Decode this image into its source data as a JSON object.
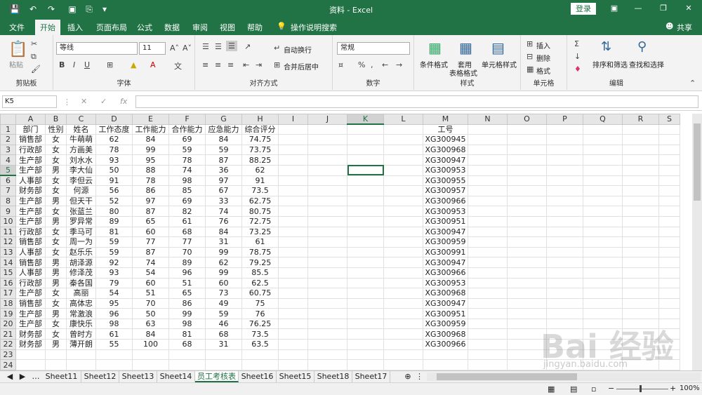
{
  "title": "资料 - Excel",
  "login_label": "登录",
  "share_label": "共享",
  "tell_me": "操作说明搜索",
  "tabs": [
    "文件",
    "开始",
    "插入",
    "页面布局",
    "公式",
    "数据",
    "审阅",
    "视图",
    "帮助"
  ],
  "active_tab": "开始",
  "ribbon": {
    "clipboard": {
      "paste": "粘贴",
      "label": "剪贴板"
    },
    "font": {
      "name": "等线",
      "size": "11",
      "label": "字体",
      "bold": "B",
      "italic": "I",
      "underline": "U"
    },
    "align": {
      "wrap": "自动换行",
      "merge": "合并后居中",
      "label": "对齐方式"
    },
    "number": {
      "format": "常规",
      "label": "数字"
    },
    "styles": {
      "cond": "条件格式",
      "table1": "套用",
      "table2": "表格格式",
      "cell": "单元格样式",
      "label": "样式"
    },
    "cells": {
      "insert": "插入",
      "delete": "删除",
      "format": "格式",
      "label": "单元格"
    },
    "edit": {
      "sort": "排序和筛选",
      "find": "查找和选择",
      "label": "编辑"
    }
  },
  "namebox": "K5",
  "fx": "fx",
  "columns": [
    "A",
    "B",
    "C",
    "D",
    "E",
    "F",
    "G",
    "H",
    "I",
    "J",
    "K",
    "L",
    "M",
    "N",
    "O",
    "P",
    "Q",
    "R",
    "S"
  ],
  "selected_col": "K",
  "selected_row": 5,
  "headers": [
    "部门",
    "性别",
    "姓名",
    "工作态度",
    "工作能力",
    "合作能力",
    "应急能力",
    "综合评分"
  ],
  "id_header": "工号",
  "rows": [
    [
      "销售部",
      "女",
      "牛萌萌",
      "62",
      "84",
      "69",
      "84",
      "74.75",
      "XG300945"
    ],
    [
      "行政部",
      "女",
      "方画美",
      "78",
      "99",
      "59",
      "59",
      "73.75",
      "XG300968"
    ],
    [
      "生产部",
      "女",
      "刘水水",
      "93",
      "95",
      "78",
      "87",
      "88.25",
      "XG300947"
    ],
    [
      "生产部",
      "男",
      "李大仙",
      "50",
      "88",
      "74",
      "36",
      "62",
      "XG300953"
    ],
    [
      "人事部",
      "女",
      "李但云",
      "91",
      "78",
      "98",
      "97",
      "91",
      "XG300955"
    ],
    [
      "财务部",
      "女",
      "何源",
      "56",
      "86",
      "85",
      "67",
      "73.5",
      "XG300957"
    ],
    [
      "生产部",
      "男",
      "但天干",
      "52",
      "97",
      "69",
      "33",
      "62.75",
      "XG300966"
    ],
    [
      "生产部",
      "女",
      "张蓝兰",
      "80",
      "87",
      "82",
      "74",
      "80.75",
      "XG300953"
    ],
    [
      "生产部",
      "男",
      "罗异常",
      "89",
      "65",
      "61",
      "76",
      "72.75",
      "XG300951"
    ],
    [
      "行政部",
      "女",
      "季马可",
      "81",
      "60",
      "68",
      "84",
      "73.25",
      "XG300947"
    ],
    [
      "销售部",
      "女",
      "周一为",
      "59",
      "77",
      "77",
      "31",
      "61",
      "XG300959"
    ],
    [
      "人事部",
      "女",
      "赵乐乐",
      "59",
      "87",
      "70",
      "99",
      "78.75",
      "XG300991"
    ],
    [
      "销售部",
      "男",
      "胡泽源",
      "92",
      "74",
      "89",
      "62",
      "79.25",
      "XG300947"
    ],
    [
      "人事部",
      "男",
      "修泽茂",
      "93",
      "54",
      "96",
      "99",
      "85.5",
      "XG300966"
    ],
    [
      "行政部",
      "男",
      "秦各国",
      "79",
      "60",
      "51",
      "60",
      "62.5",
      "XG300953"
    ],
    [
      "生产部",
      "女",
      "高丽",
      "54",
      "51",
      "65",
      "73",
      "60.75",
      "XG300968"
    ],
    [
      "销售部",
      "女",
      "高体忠",
      "95",
      "70",
      "86",
      "49",
      "75",
      "XG300947"
    ],
    [
      "生产部",
      "男",
      "常激浪",
      "96",
      "50",
      "99",
      "59",
      "76",
      "XG300951"
    ],
    [
      "生产部",
      "女",
      "康快乐",
      "98",
      "63",
      "98",
      "46",
      "76.25",
      "XG300959"
    ],
    [
      "财务部",
      "女",
      "曾时方",
      "61",
      "84",
      "81",
      "68",
      "73.5",
      "XG300968"
    ],
    [
      "财务部",
      "男",
      "薄开朗",
      "55",
      "100",
      "68",
      "31",
      "63.5",
      "XG300966"
    ]
  ],
  "sheets": [
    "Sheet11",
    "Sheet12",
    "Sheet13",
    "Sheet14",
    "员工考核表",
    "Sheet16",
    "Sheet15",
    "Sheet18",
    "Sheet17"
  ],
  "active_sheet": "员工考核表",
  "zoom": "100%",
  "watermark": "Bai 经验",
  "watermark_url": "jingyan.baidu.com",
  "colors": {
    "accent": "#217346"
  }
}
